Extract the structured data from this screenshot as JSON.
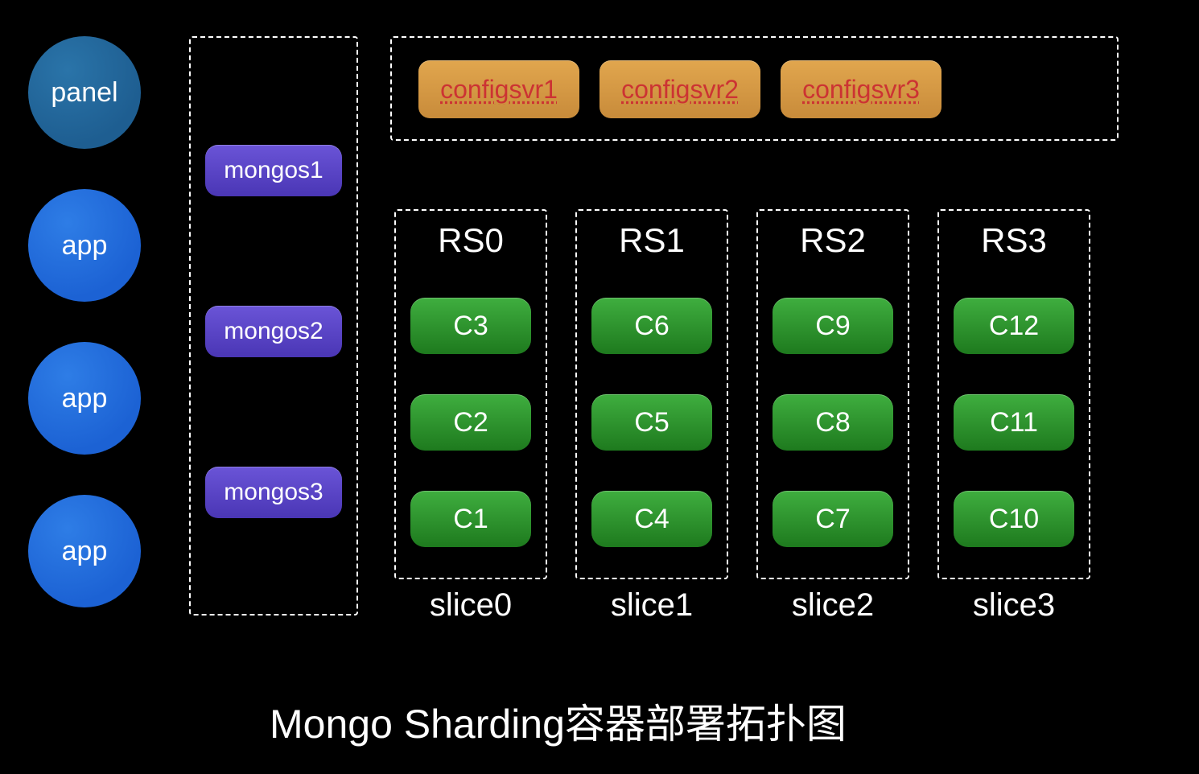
{
  "clients": {
    "panel": "panel",
    "app1": "app",
    "app2": "app",
    "app3": "app"
  },
  "mongos": {
    "m1": "mongos1",
    "m2": "mongos2",
    "m3": "mongos3"
  },
  "configsvr": {
    "c1": "configsvr1",
    "c2": "configsvr2",
    "c3": "configsvr3"
  },
  "rs": {
    "rs0": {
      "title": "RS0",
      "n1": "C3",
      "n2": "C2",
      "n3": "C1",
      "slice": "slice0"
    },
    "rs1": {
      "title": "RS1",
      "n1": "C6",
      "n2": "C5",
      "n3": "C4",
      "slice": "slice1"
    },
    "rs2": {
      "title": "RS2",
      "n1": "C9",
      "n2": "C8",
      "n3": "C7",
      "slice": "slice2"
    },
    "rs3": {
      "title": "RS3",
      "n1": "C12",
      "n2": "C11",
      "n3": "C10",
      "slice": "slice3"
    }
  },
  "title": "Mongo Sharding容器部署拓扑图"
}
